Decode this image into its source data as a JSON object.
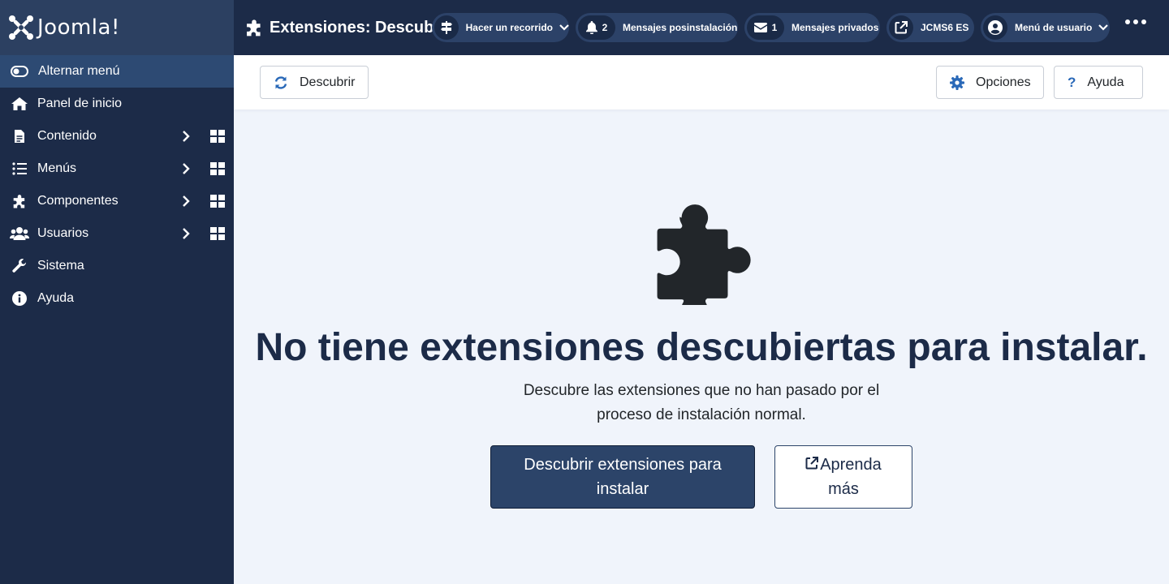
{
  "brand": {
    "name": "Joomla!"
  },
  "sidebar": {
    "toggle_label": "Alternar menú",
    "items": [
      {
        "label": "Panel de inicio",
        "icon": "home-icon",
        "submenu": false
      },
      {
        "label": "Contenido",
        "icon": "file-icon",
        "submenu": true
      },
      {
        "label": "Menús",
        "icon": "list-icon",
        "submenu": true
      },
      {
        "label": "Componentes",
        "icon": "puzzle-icon",
        "submenu": true
      },
      {
        "label": "Usuarios",
        "icon": "users-icon",
        "submenu": true
      },
      {
        "label": "Sistema",
        "icon": "wrench-icon",
        "submenu": false
      },
      {
        "label": "Ayuda",
        "icon": "info-icon",
        "submenu": false
      }
    ]
  },
  "header": {
    "title": "Extensiones: Descubrir",
    "tour_label": "Hacer un recorrido",
    "postinstall_count": "2",
    "postinstall_label": "Mensajes posinstalación",
    "private_count": "1",
    "private_label": "Mensajes privados",
    "site_label": "JCMS6 ES",
    "user_menu_label": "Menú de usuario"
  },
  "toolbar": {
    "discover_label": "Descubrir",
    "options_label": "Opciones",
    "help_label": "Ayuda"
  },
  "empty_state": {
    "title": "No tiene extensiones descubiertas para instalar.",
    "description": "Descubre las extensiones que no han pasado por el proceso de instalación normal.",
    "primary_label": "Descubrir extensiones para instalar",
    "secondary_label": "Aprenda más"
  },
  "colors": {
    "sidebar_bg": "#1c2b48",
    "brand_bg": "#2c4061",
    "toggle_bg": "#2d4a73",
    "pill_bg": "#2c4268",
    "primary_button": "#2c4469",
    "page_bg": "#f0f4fb",
    "accent_blue": "#2a69b8"
  }
}
